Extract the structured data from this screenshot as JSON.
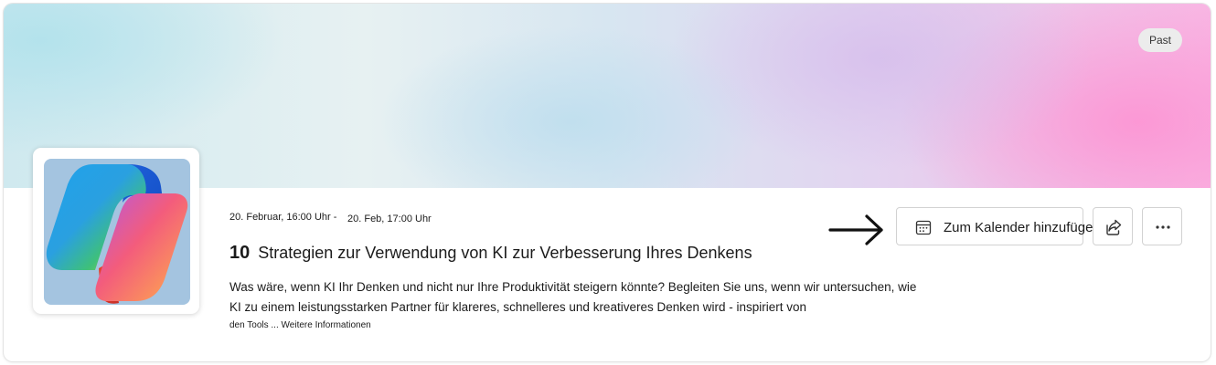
{
  "event": {
    "status_badge": "Past",
    "start": "20. Februar, 16:00 Uhr -",
    "end": "20. Feb, 17:00 Uhr",
    "title_number": "10",
    "title": "Strategien zur Verwendung von KI zur Verbesserung Ihres Denkens",
    "description_line1": "Was wäre, wenn KI Ihr Denken und nicht nur Ihre Produktivität steigern könnte? Begleiten Sie uns, wenn wir untersuchen, wie",
    "description_line2": "KI zu einem leistungsstarken Partner für klareres, schnelleres und kreativeres Denken wird - inspiriert von",
    "description_tail": "den Tools ...",
    "more_link": "Weitere Informationen"
  },
  "actions": {
    "add_to_calendar": "Zum Kalender hinzufügen",
    "share_icon": "share-icon",
    "more_icon": "more-options-icon",
    "calendar_icon": "calendar-icon"
  },
  "colors": {
    "banner_left": "#cfe9ef",
    "banner_right": "#f8b8e4",
    "logo_tile_bg": "#a4c4e0"
  }
}
